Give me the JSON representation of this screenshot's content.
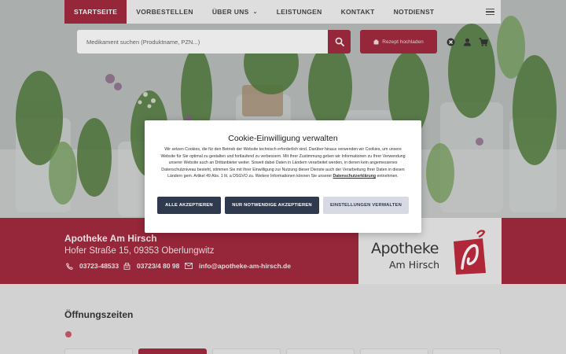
{
  "nav": {
    "items": [
      {
        "label": "STARTSEITE",
        "active": true
      },
      {
        "label": "VORBESTELLEN",
        "active": false
      },
      {
        "label": "ÜBER UNS",
        "active": false,
        "has_dropdown": true
      },
      {
        "label": "LEISTUNGEN",
        "active": false
      },
      {
        "label": "KONTAKT",
        "active": false
      },
      {
        "label": "NOTDIENST",
        "active": false
      }
    ],
    "menu_icon": "hamburger-icon"
  },
  "search": {
    "placeholder": "Medikament suchen (Produktname, PZN...)",
    "button_icon": "search-icon"
  },
  "rezept": {
    "label": "Rezept hochladen",
    "icon": "prescription-icon"
  },
  "toolbar": {
    "icons": [
      "close-circle-icon",
      "user-icon",
      "cart-icon"
    ]
  },
  "pharmacy": {
    "name": "Apotheke Am Hirsch",
    "address": "Hofer Straße 15, 09353 Oberlungwitz",
    "phone": "03723-48533",
    "fax": "03723/4 80 98",
    "email": "info@apotheke-am-hirsch.de",
    "logo_line1": "Apotheke",
    "logo_line2": "Am Hirsch"
  },
  "hours": {
    "title": "Öffnungszeiten"
  },
  "cookie": {
    "title": "Cookie-Einwilligung verwalten",
    "text_before_link": "Wir setzen Cookies, die für den Betrieb der Website technisch erforderlich sind. Darüber hinaus verwenden wir Cookies, um unsere Website für Sie optimal zu gestalten und fortlaufend zu verbessern. Mit Ihrer Zustimmung geben wir Informationen zu Ihrer Verwendung unserer Website auch an Drittanbieter weiter. Soweit dabei Daten in Ländern verarbeitet werden, in denen kein angemessenes Datenschutzniveau besteht, stimmen Sie mit Ihrer Einwilligung zur Nutzung dieser Dienste auch der Verarbeitung Ihrer Daten in diesen Ländern gem. Artikel 49 Abs. 1 lit. a DSGVO zu. Weitere Informationen können Sie unserer",
    "link": "Datenschutzerklärung",
    "text_after_link": "entnehmen.",
    "btn_accept_all": "ALLE AKZEPTIEREN",
    "btn_necessary": "NUR NOTWENDIGE AKZEPTIEREN",
    "btn_settings": "EINSTELLUNGEN VERWALTEN"
  },
  "colors": {
    "brand": "#a3263c",
    "modal_button_dark": "#303a4e",
    "modal_button_light": "#d7dae3"
  }
}
